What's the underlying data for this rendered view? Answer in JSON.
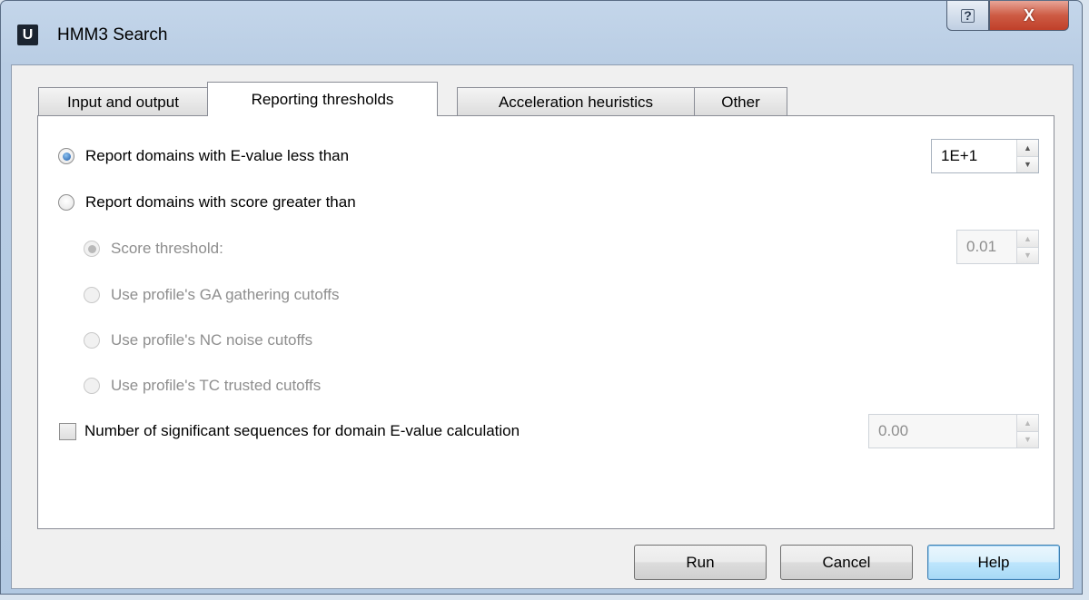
{
  "window": {
    "icon_letter": "U",
    "title": "HMM3 Search",
    "help_glyph": "?",
    "close_glyph": "X"
  },
  "tabs": [
    {
      "label": "Input and output",
      "active": false
    },
    {
      "label": "Reporting thresholds",
      "active": true
    },
    {
      "label": "Acceleration heuristics",
      "active": false
    },
    {
      "label": "Other",
      "active": false
    }
  ],
  "reporting": {
    "evalue_option": {
      "label": "Report domains with E-value less than",
      "checked": true
    },
    "evalue_value": "1E+1",
    "score_option": {
      "label": "Report domains with score greater than",
      "checked": false
    },
    "score_threshold": {
      "label": "Score threshold:",
      "checked": true,
      "enabled": false
    },
    "score_threshold_value": "0.01",
    "ga_cutoffs": {
      "label": "Use profile's GA gathering cutoffs",
      "enabled": false
    },
    "nc_cutoffs": {
      "label": "Use profile's NC noise cutoffs",
      "enabled": false
    },
    "tc_cutoffs": {
      "label": "Use profile's TC trusted cutoffs",
      "enabled": false
    },
    "significant_seqs": {
      "label": "Number of significant sequences for domain E-value calculation",
      "checked": false
    },
    "significant_seqs_value": "0.00"
  },
  "buttons": {
    "run": "Run",
    "cancel": "Cancel",
    "help": "Help"
  },
  "colors": {
    "titlebar": "#b9cde4",
    "close_button": "#c94a33",
    "default_button_border": "#3c7fb1"
  }
}
